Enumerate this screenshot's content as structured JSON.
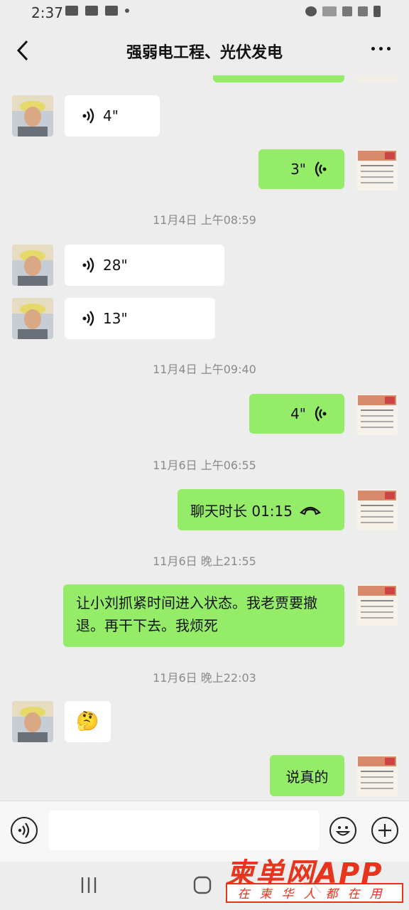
{
  "status_bar": {
    "time": "2:37"
  },
  "header": {
    "title": "强弱电工程、光伏发电"
  },
  "messages": [
    {
      "side": "left",
      "text": "4\""
    },
    {
      "side": "right",
      "text": "3\""
    },
    {
      "timestamp": "11月4日 上午08:59"
    },
    {
      "side": "left",
      "text": "28\""
    },
    {
      "side": "left",
      "text": "13\""
    },
    {
      "timestamp": "11月4日 上午09:40"
    },
    {
      "side": "right",
      "text": "4\""
    },
    {
      "timestamp": "11月6日 上午06:55"
    },
    {
      "side": "right",
      "text": "聊天时长 01:15"
    },
    {
      "timestamp": "11月6日 晚上21:55"
    },
    {
      "side": "right",
      "text": "让小刘抓紧时间进入状态。我老贾要撤退。再干下去。我烦死"
    },
    {
      "timestamp": "11月6日 晚上22:03"
    },
    {
      "side": "left",
      "emoji": "🤔"
    },
    {
      "side": "right",
      "text": "说真的"
    }
  ],
  "watermark": {
    "title": "柬单网APP",
    "subtitle": "在柬华人都在用"
  },
  "colors": {
    "bubble_right": "#95ec69",
    "bubble_left": "#ffffff",
    "background": "#ededed",
    "watermark": "#e8341d"
  }
}
